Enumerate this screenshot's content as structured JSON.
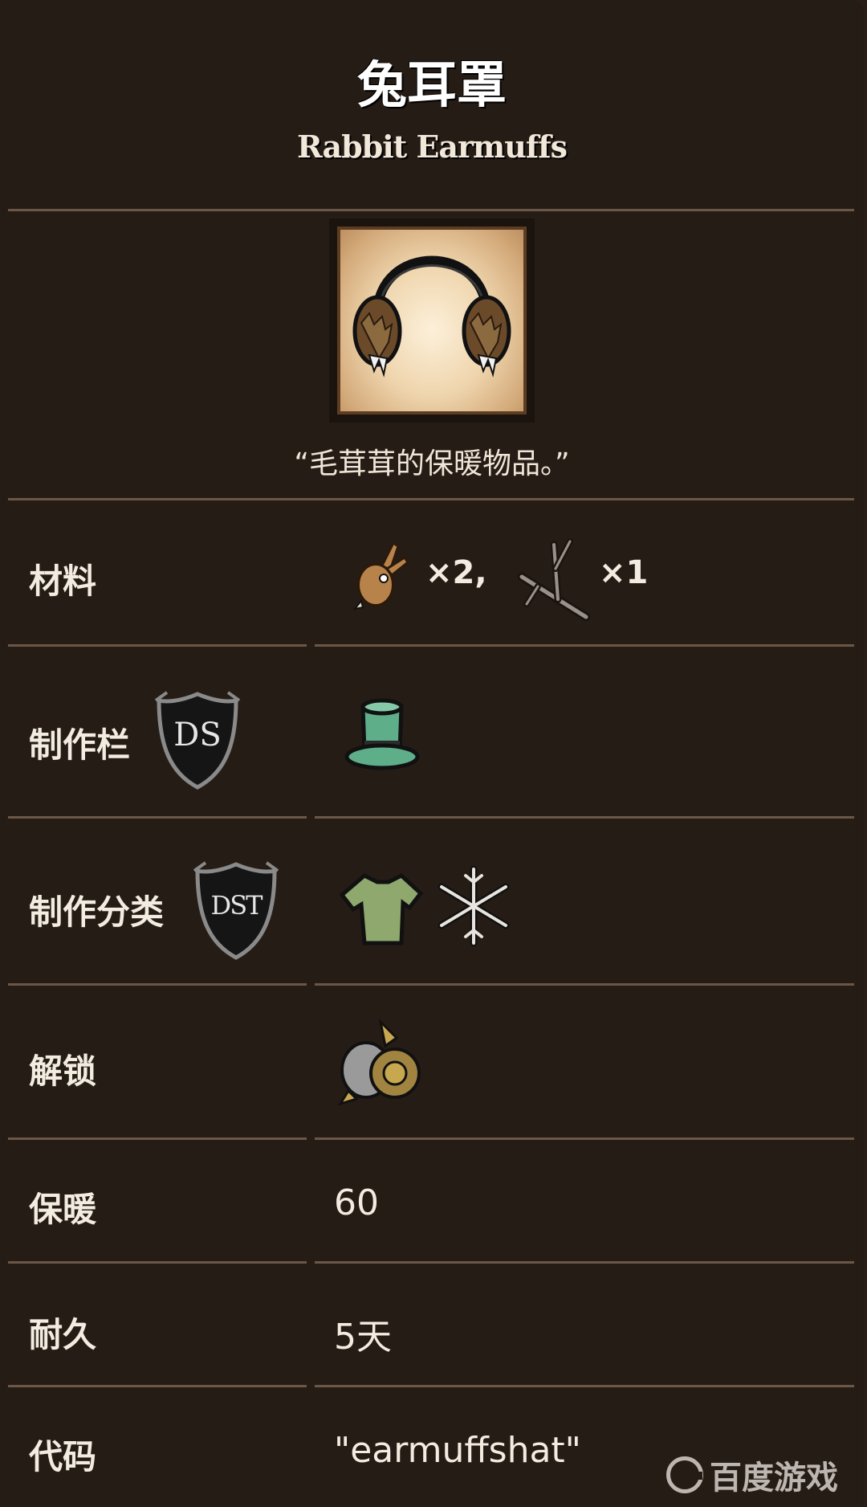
{
  "header": {
    "title": "兔耳罩",
    "subtitle": "Rabbit Earmuffs"
  },
  "item": {
    "quote": "“毛茸茸的保暖物品。”",
    "portrait_icon": "earmuffs-icon"
  },
  "rows": {
    "materials": {
      "label": "材料",
      "ingredients": [
        {
          "icon": "rabbit-icon",
          "qty": "×2,"
        },
        {
          "icon": "twigs-icon",
          "qty": "×1"
        }
      ]
    },
    "craft_tab": {
      "label": "制作栏",
      "badge": "DS",
      "icon": "top-hat-icon"
    },
    "craft_category": {
      "label": "制作分类",
      "badge": "DST",
      "icons": [
        "shirt-icon",
        "snowflake-icon"
      ]
    },
    "unlock": {
      "label": "解锁",
      "icon": "science-machine-icon"
    },
    "insulation": {
      "label": "保暖",
      "value": "60"
    },
    "durability": {
      "label": "耐久",
      "value": "5天"
    },
    "code": {
      "label": "代码",
      "value": "\"earmuffshat\""
    }
  },
  "watermark": {
    "text": "百度游戏"
  },
  "colors": {
    "background": "#261c16",
    "divider": "#6b5747",
    "text": "#f3ece0",
    "hat_green": "#5fae8a"
  }
}
